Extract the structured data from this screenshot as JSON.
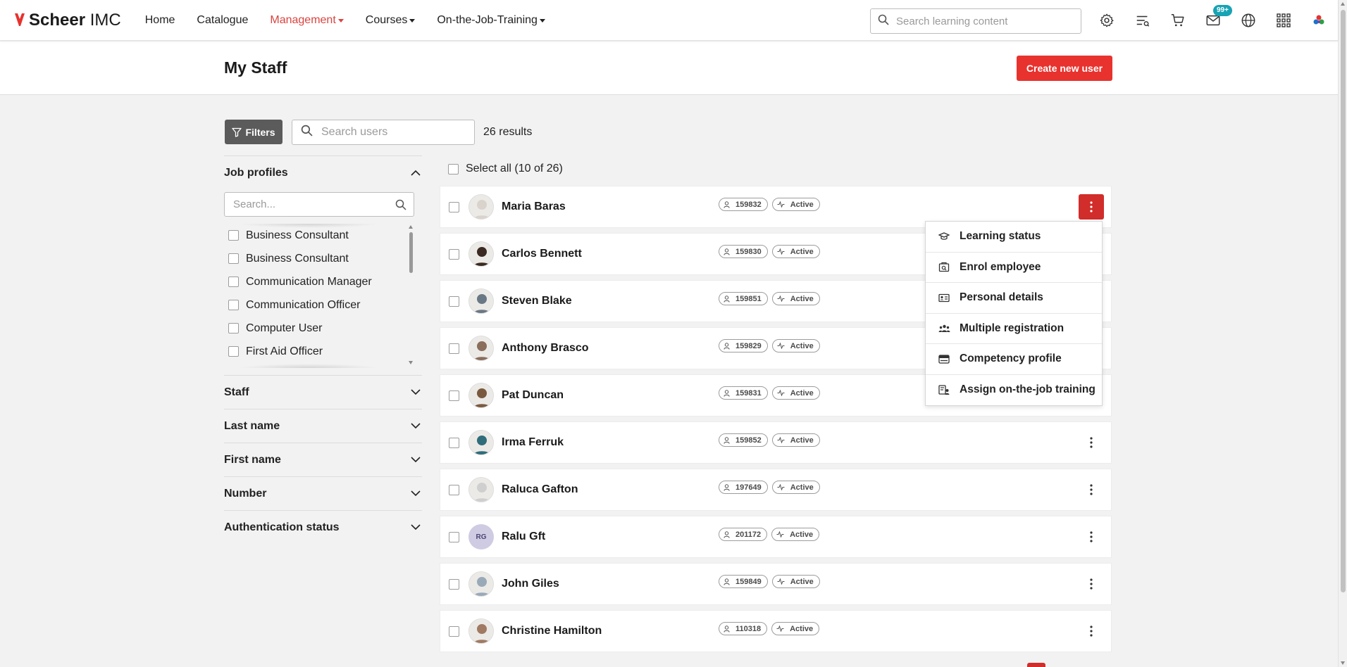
{
  "brand": {
    "name_bold": "Scheer",
    "name_rest": " IMC",
    "accent": "#e8322e"
  },
  "nav": {
    "items": [
      {
        "label": "Home",
        "active": false,
        "dropdown": false
      },
      {
        "label": "Catalogue",
        "active": false,
        "dropdown": false
      },
      {
        "label": "Management",
        "active": true,
        "dropdown": true
      },
      {
        "label": "Courses",
        "active": false,
        "dropdown": true
      },
      {
        "label": "On-the-Job-Training",
        "active": false,
        "dropdown": true
      }
    ],
    "search_placeholder": "Search learning content",
    "icons": [
      "gear-icon",
      "task-list-icon",
      "cart-icon",
      "mail-icon",
      "globe-icon",
      "app-grid-icon",
      "company-logo-icon"
    ],
    "mail_badge": "99+"
  },
  "header": {
    "title": "My Staff",
    "create_button": "Create new user"
  },
  "toolbar": {
    "filters_label": "Filters",
    "search_placeholder": "Search users",
    "result_count": "26 results"
  },
  "filters": {
    "job_profiles": {
      "title": "Job profiles",
      "search_placeholder": "Search...",
      "items": [
        "Business Consultant",
        "Business Consultant",
        "Communication Manager",
        "Communication Officer",
        "Computer User",
        "First Aid Officer"
      ]
    },
    "sections": [
      "Staff",
      "Last name",
      "First name",
      "Number",
      "Authentication status"
    ]
  },
  "select_all": "Select all (10 of 26)",
  "users": [
    {
      "name": "Maria Baras",
      "id": "159832",
      "status": "Active",
      "avatar_color": "#d9d3cc"
    },
    {
      "name": "Carlos Bennett",
      "id": "159830",
      "status": "Active",
      "avatar_color": "#3b2a22"
    },
    {
      "name": "Steven Blake",
      "id": "159851",
      "status": "Active",
      "avatar_color": "#6a7784"
    },
    {
      "name": "Anthony Brasco",
      "id": "159829",
      "status": "Active",
      "avatar_color": "#8a6d5b"
    },
    {
      "name": "Pat Duncan",
      "id": "159831",
      "status": "Active",
      "avatar_color": "#7a5a3f"
    },
    {
      "name": "Irma Ferruk",
      "id": "159852",
      "status": "Active",
      "avatar_color": "#2f6d7a"
    },
    {
      "name": "Raluca Gafton",
      "id": "197649",
      "status": "Active",
      "avatar_color": "#cfcfcf"
    },
    {
      "name": "Ralu Gft",
      "id": "201172",
      "status": "Active",
      "initials": "RG"
    },
    {
      "name": "John Giles",
      "id": "159849",
      "status": "Active",
      "avatar_color": "#9aa9b8"
    },
    {
      "name": "Christine Hamilton",
      "id": "110318",
      "status": "Active",
      "avatar_color": "#a07a62"
    }
  ],
  "action_menu": [
    {
      "label": "Learning status",
      "icon": "graduation-cap-icon"
    },
    {
      "label": "Enrol employee",
      "icon": "enrol-icon"
    },
    {
      "label": "Personal details",
      "icon": "id-card-icon"
    },
    {
      "label": "Multiple registration",
      "icon": "group-icon"
    },
    {
      "label": "Competency profile",
      "icon": "competency-icon"
    },
    {
      "label": "Assign on-the-job training",
      "icon": "assign-training-icon"
    }
  ],
  "colors": {
    "accent": "#e8322e",
    "kebab_active": "#d12d2a",
    "badge": "#17a3b4",
    "filters_button": "#5b5b5b"
  }
}
